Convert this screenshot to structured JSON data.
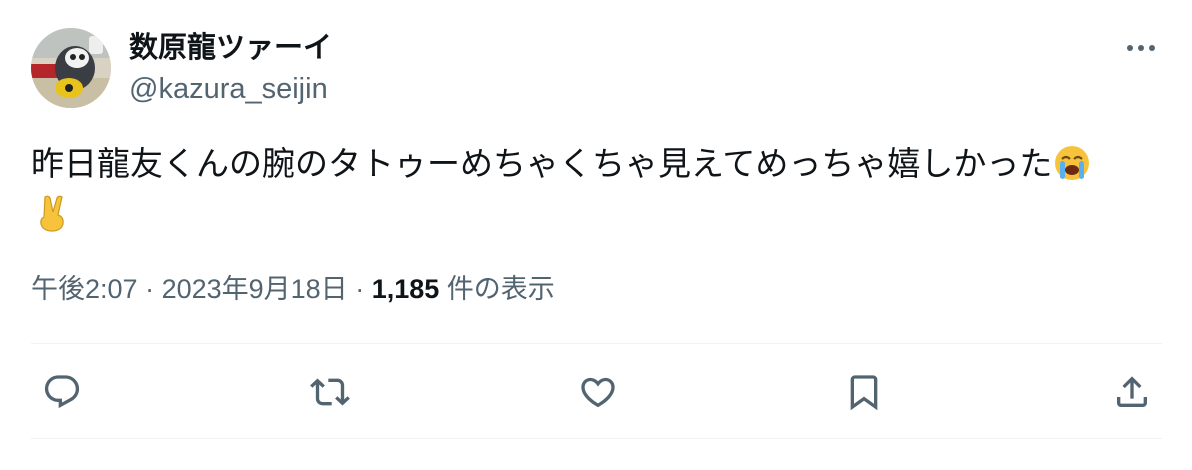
{
  "author": {
    "display_name": "数原龍ツァーイ",
    "handle": "@kazura_seijin"
  },
  "tweet": {
    "text": "昨日龍友くんの腕のタトゥーめちゃくちゃ見えてめっちゃ嬉しかった",
    "emojis": [
      "loudly-crying-face",
      "victory-hand"
    ]
  },
  "meta": {
    "time": "午後2:07",
    "separator1": " · ",
    "date": "2023年9月18日",
    "separator2": " · ",
    "views_count": "1,185",
    "views_label": " 件の表示"
  },
  "actions": {
    "icons": [
      "reply-icon",
      "retweet-icon",
      "like-icon",
      "bookmark-icon",
      "share-icon"
    ]
  },
  "colors": {
    "text": "#0f1419",
    "secondary": "#536471",
    "divider": "#eff3f4"
  }
}
